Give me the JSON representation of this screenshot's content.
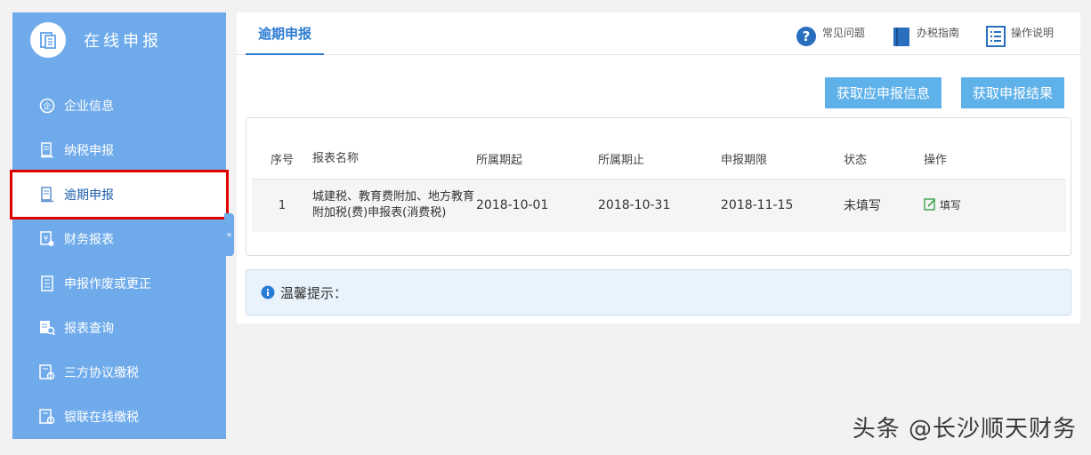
{
  "sidebar": {
    "title": "在线申报",
    "items": [
      {
        "label": "企业信息",
        "icon": "enterprise-icon"
      },
      {
        "label": "纳税申报",
        "icon": "tax-filing-icon"
      },
      {
        "label": "逾期申报",
        "icon": "overdue-filing-icon",
        "active": true
      },
      {
        "label": "财务报表",
        "icon": "financial-report-icon"
      },
      {
        "label": "申报作废或更正",
        "icon": "void-correct-icon"
      },
      {
        "label": "报表查询",
        "icon": "report-query-icon"
      },
      {
        "label": "三方协议缴税",
        "icon": "tripartite-payment-icon"
      },
      {
        "label": "银联在线缴税",
        "icon": "unionpay-payment-icon"
      }
    ],
    "collapse_glyph": "«"
  },
  "header": {
    "active_tab": "逾期申报",
    "links": [
      {
        "label": "常见问题",
        "icon": "question-icon"
      },
      {
        "label": "办税指南",
        "icon": "book-icon"
      },
      {
        "label": "操作说明",
        "icon": "list-icon"
      }
    ]
  },
  "actions": {
    "fetch_info": "获取应申报信息",
    "fetch_result": "获取申报结果"
  },
  "table": {
    "columns": [
      "序号",
      "报表名称",
      "所属期起",
      "所属期止",
      "申报期限",
      "状态",
      "操作"
    ],
    "rows": [
      {
        "index": "1",
        "name": "城建税、教育费附加、地方教育附加税(费)申报表(消费税)",
        "start": "2018-10-01",
        "end": "2018-10-31",
        "deadline": "2018-11-15",
        "status": "未填写",
        "action": "填写"
      }
    ]
  },
  "tip": {
    "label": "温馨提示："
  },
  "watermark": "头条 @长沙顺天财务",
  "colors": {
    "sidebar": "#6fabeb",
    "accent": "#2a7bd3",
    "button": "#5fb1ea",
    "highlight": "#e00000"
  }
}
